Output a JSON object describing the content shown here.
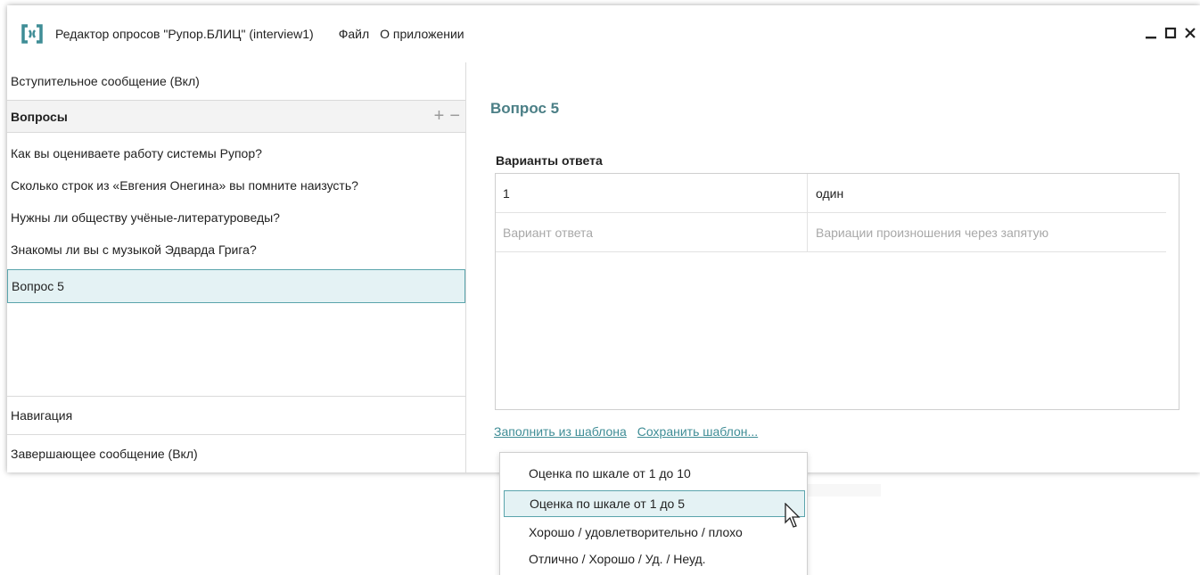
{
  "window": {
    "title": "Редактор опросов \"Рупор.БЛИЦ\" (interview1)",
    "menu": [
      "Файл",
      "О приложении"
    ],
    "controls": {
      "minimize": "_",
      "maximize": "☐",
      "close": "✕"
    }
  },
  "sidebar": {
    "intro": "Вступительное сообщение (Вкл)",
    "questions_header": "Вопросы",
    "add_symbol": "+",
    "remove_symbol": "−",
    "questions": [
      "Как вы оцениваете работу системы Рупор?",
      "Сколько строк из «Евгения Онегина» вы помните наизусть?",
      "Нужны ли обществу учёные-литературоведы?",
      "Знакомы ли вы с музыкой Эдварда Грига?",
      "Вопрос 5"
    ],
    "selected_index": 4,
    "navigation": "Навигация",
    "outro": "Завершающее сообщение (Вкл)"
  },
  "editor": {
    "title": "Вопрос 5",
    "answers_label": "Варианты ответа",
    "rows": [
      {
        "answer": "1",
        "variants": "один"
      }
    ],
    "new_row": {
      "answer_placeholder": "Вариант ответа",
      "variants_placeholder": "Вариации произношения через запятую"
    },
    "fill_template_link": "Заполнить из шаблона",
    "save_template_link": "Сохранить шаблон..."
  },
  "template_menu": {
    "items": [
      "Оценка по шкале от 1 до 10",
      "Оценка по шкале от 1 до 5",
      "Хорошо / удовлетворительно / плохо",
      "Отлично / Хорошо / Уд. / Неуд."
    ],
    "highlighted_index": 1
  },
  "colors": {
    "accent": "#4b7f86",
    "link": "#3f8d96",
    "selection_bg": "#e4f2f4",
    "selection_border": "#5aa4ac"
  }
}
